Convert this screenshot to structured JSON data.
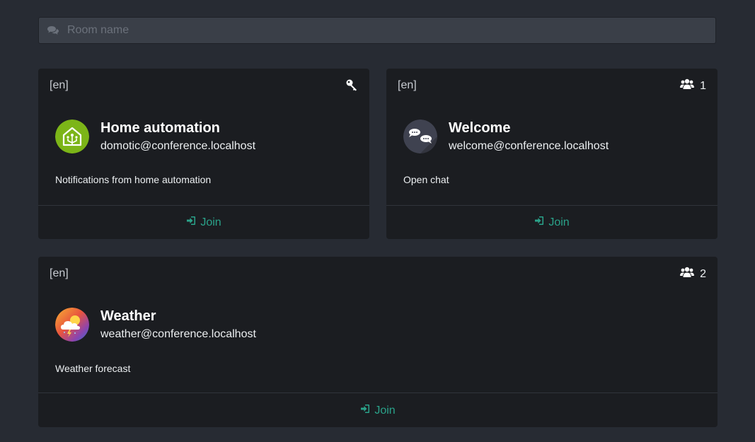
{
  "search": {
    "placeholder": "Room name",
    "value": ""
  },
  "join_label": "Join",
  "rooms": [
    {
      "lang": "[en]",
      "name": "Home automation",
      "jid": "domotic@conference.localhost",
      "description": "Notifications from home automation",
      "indicator_icon": "key-icon",
      "occupants": ""
    },
    {
      "lang": "[en]",
      "name": "Welcome",
      "jid": "welcome@conference.localhost",
      "description": "Open chat",
      "indicator_icon": "users-icon",
      "occupants": "1"
    },
    {
      "lang": "[en]",
      "name": "Weather",
      "jid": "weather@conference.localhost",
      "description": "Weather forecast",
      "indicator_icon": "users-icon",
      "occupants": "2"
    }
  ],
  "colors": {
    "background": "#272b33",
    "card": "#1b1d21",
    "accent": "#2aa38a",
    "home_avatar": "#7cb518"
  }
}
